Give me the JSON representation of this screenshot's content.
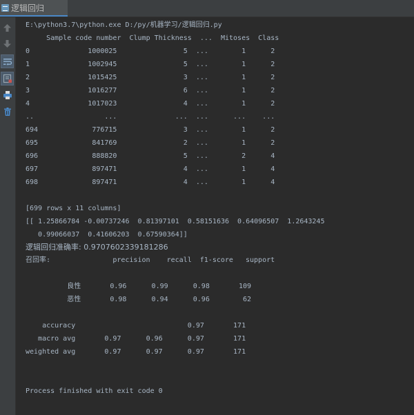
{
  "tab": {
    "title": "逻辑回归"
  },
  "toolbar": {
    "icons": [
      "arrow-up-icon",
      "arrow-down-icon",
      "soft-wrap-icon",
      "scroll-to-end-icon",
      "print-icon",
      "trash-icon"
    ]
  },
  "console": {
    "lines": [
      "E:\\python3.7\\python.exe D:/py/机器学习/逻辑回归.py",
      "     Sample code number  Clump Thickness  ...  Mitoses  Class",
      "0              1000025                5  ...        1      2",
      "1              1002945                5  ...        1      2",
      "2              1015425                3  ...        1      2",
      "3              1016277                6  ...        1      2",
      "4              1017023                4  ...        1      2",
      "..                 ...              ...  ...      ...    ...",
      "694             776715                3  ...        1      2",
      "695             841769                2  ...        1      2",
      "696             888820                5  ...        2      4",
      "697             897471                4  ...        1      4",
      "698             897471                4  ...        1      4",
      "",
      "[699 rows x 11 columns]",
      "[[ 1.25866784 -0.00737246  0.81397101  0.58151636  0.64096507  1.2643245",
      "   0.99066037  0.41606203  0.67590364]]",
      "逻辑回归准确率: 0.9707602339181286",
      "召回率:               precision    recall  f1-score   support",
      "",
      "          良性       0.96      0.99      0.98       109",
      "          恶性       0.98      0.94      0.96        62",
      "",
      "    accuracy                           0.97       171",
      "   macro avg       0.97      0.96      0.97       171",
      "weighted avg       0.97      0.97      0.97       171",
      "",
      "",
      "Process finished with exit code 0"
    ]
  }
}
